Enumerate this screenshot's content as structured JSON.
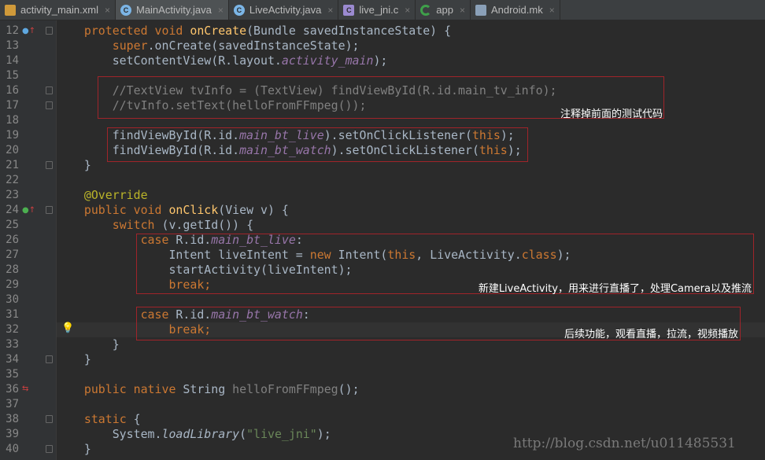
{
  "tabs": [
    {
      "label": "activity_main.xml",
      "icon": "xml-file-icon",
      "active": false
    },
    {
      "label": "MainActivity.java",
      "icon": "java-class-icon",
      "active": true
    },
    {
      "label": "LiveActivity.java",
      "icon": "java-class-icon",
      "active": false
    },
    {
      "label": "live_jni.c",
      "icon": "c-file-icon",
      "active": false
    },
    {
      "label": "app",
      "icon": "gradle-module-icon",
      "active": false
    },
    {
      "label": "Android.mk",
      "icon": "makefile-icon",
      "active": false
    }
  ],
  "close_glyph": "×",
  "current_line": 32,
  "lines": [
    {
      "n": "12",
      "t": [
        [
          "    ",
          ""
        ],
        [
          "protected void ",
          "kw"
        ],
        [
          "onCreate",
          "fn"
        ],
        [
          "(Bundle savedInstanceState) {",
          ""
        ]
      ]
    },
    {
      "n": "13",
      "t": [
        [
          "        ",
          ""
        ],
        [
          "super",
          "kw"
        ],
        [
          ".onCreate(savedInstanceState);",
          ""
        ]
      ]
    },
    {
      "n": "14",
      "t": [
        [
          "        setContentView(R.layout.",
          ""
        ],
        [
          "activity_main",
          "fld"
        ],
        [
          ");",
          ""
        ]
      ]
    },
    {
      "n": "15",
      "t": []
    },
    {
      "n": "16",
      "t": [
        [
          "        //TextView tvInfo = (TextView) findViewById(R.id.main_tv_info);",
          "cm"
        ]
      ]
    },
    {
      "n": "17",
      "t": [
        [
          "        //tvInfo.setText(helloFromFFmpeg());",
          "cm"
        ]
      ]
    },
    {
      "n": "18",
      "t": []
    },
    {
      "n": "19",
      "t": [
        [
          "        findViewById(R.id.",
          ""
        ],
        [
          "main_bt_live",
          "fld"
        ],
        [
          ").setOnClickListener(",
          ""
        ],
        [
          "this",
          "kw"
        ],
        [
          ");",
          ""
        ]
      ]
    },
    {
      "n": "20",
      "t": [
        [
          "        findViewById(R.id.",
          ""
        ],
        [
          "main_bt_watch",
          "fld"
        ],
        [
          ").setOnClickListener(",
          ""
        ],
        [
          "this",
          "kw"
        ],
        [
          ");",
          ""
        ]
      ]
    },
    {
      "n": "21",
      "t": [
        [
          "    }",
          ""
        ]
      ]
    },
    {
      "n": "22",
      "t": []
    },
    {
      "n": "23",
      "t": [
        [
          "    ",
          ""
        ],
        [
          "@Override",
          "ann"
        ]
      ]
    },
    {
      "n": "24",
      "t": [
        [
          "    ",
          ""
        ],
        [
          "public void ",
          "kw"
        ],
        [
          "onClick",
          "fn"
        ],
        [
          "(View v) {",
          ""
        ]
      ]
    },
    {
      "n": "25",
      "t": [
        [
          "        ",
          ""
        ],
        [
          "switch ",
          "kw"
        ],
        [
          "(v.getId()) {",
          ""
        ]
      ]
    },
    {
      "n": "26",
      "t": [
        [
          "            ",
          ""
        ],
        [
          "case ",
          "kw"
        ],
        [
          "R.id.",
          ""
        ],
        [
          "main_bt_live",
          "fld"
        ],
        [
          ":",
          ""
        ]
      ]
    },
    {
      "n": "27",
      "t": [
        [
          "                Intent liveIntent = ",
          ""
        ],
        [
          "new ",
          "kw"
        ],
        [
          "Intent(",
          ""
        ],
        [
          "this",
          "kw"
        ],
        [
          ", LiveActivity.",
          ""
        ],
        [
          "class",
          "kw"
        ],
        [
          ");",
          ""
        ]
      ]
    },
    {
      "n": "28",
      "t": [
        [
          "                startActivity(liveIntent);",
          ""
        ]
      ]
    },
    {
      "n": "29",
      "t": [
        [
          "                ",
          ""
        ],
        [
          "break;",
          "kw"
        ]
      ]
    },
    {
      "n": "30",
      "t": []
    },
    {
      "n": "31",
      "t": [
        [
          "            ",
          ""
        ],
        [
          "case ",
          "kw"
        ],
        [
          "R.id.",
          ""
        ],
        [
          "main_bt_watch",
          "fld"
        ],
        [
          ":",
          ""
        ]
      ]
    },
    {
      "n": "32",
      "t": [
        [
          "                ",
          ""
        ],
        [
          "break;",
          "kw"
        ]
      ]
    },
    {
      "n": "33",
      "t": [
        [
          "        }",
          ""
        ]
      ]
    },
    {
      "n": "34",
      "t": [
        [
          "    }",
          ""
        ]
      ]
    },
    {
      "n": "35",
      "t": []
    },
    {
      "n": "36",
      "t": [
        [
          "    ",
          ""
        ],
        [
          "public native ",
          "kw"
        ],
        [
          "String ",
          ""
        ],
        [
          "helloFromFFmpeg",
          "cm"
        ],
        [
          "();",
          ""
        ]
      ]
    },
    {
      "n": "37",
      "t": []
    },
    {
      "n": "38",
      "t": [
        [
          "    ",
          ""
        ],
        [
          "static ",
          "kw"
        ],
        [
          "{",
          ""
        ]
      ]
    },
    {
      "n": "39",
      "t": [
        [
          "        System.",
          ""
        ],
        [
          "loadLibrary",
          "st"
        ],
        [
          "(",
          ""
        ],
        [
          "\"live_jni\"",
          "str"
        ],
        [
          ");",
          ""
        ]
      ]
    },
    {
      "n": "40",
      "t": [
        [
          "    }",
          ""
        ]
      ]
    }
  ],
  "annotations": [
    {
      "text": "注释掉前面的测试代码"
    },
    {
      "text": "新建LiveActivity，用来进行直播了，处理Camera以及推流"
    },
    {
      "text": "后续功能，观看直播，拉流，视频播放"
    }
  ],
  "watermark": "http://blog.csdn.net/u011485531",
  "colors": {
    "background": "#2b2b2b",
    "keyword": "#cc7832",
    "method": "#ffc66d",
    "field": "#9876aa",
    "comment": "#808080",
    "string": "#6a8759",
    "annotation": "#bbb529",
    "highlight_box": "#a0242a"
  }
}
